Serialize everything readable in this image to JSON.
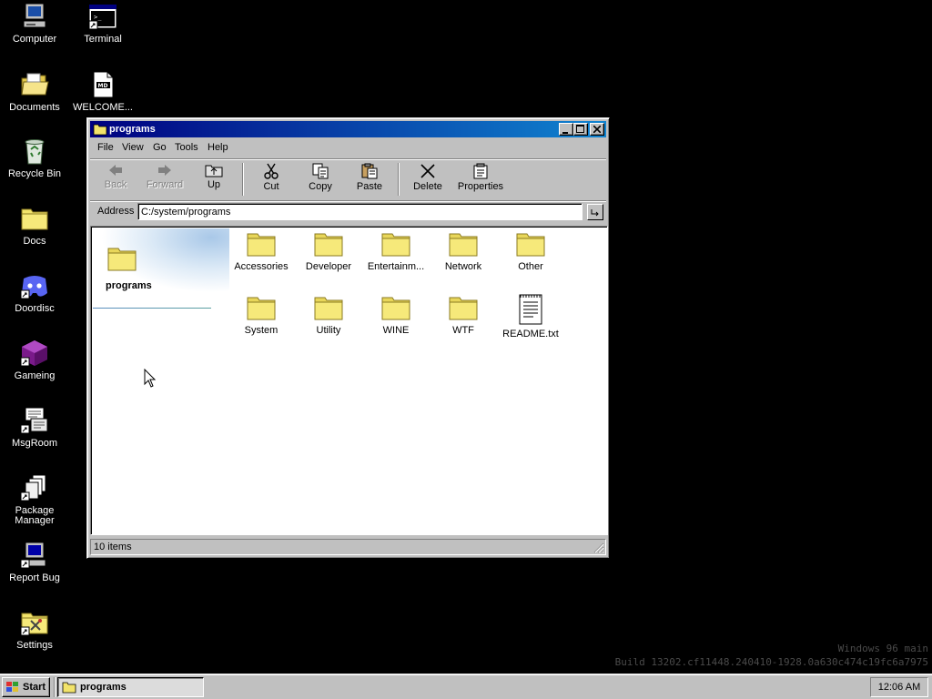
{
  "desktop": {
    "icons": [
      {
        "label": "Computer"
      },
      {
        "label": "Terminal"
      },
      {
        "label": "Documents"
      },
      {
        "label": "WELCOME...",
        "badge": "MD"
      },
      {
        "label": "Recycle Bin"
      },
      {
        "label": "Docs"
      },
      {
        "label": "Doordisc"
      },
      {
        "label": "Gameing"
      },
      {
        "label": "MsgRoom"
      },
      {
        "label": "Package Manager"
      },
      {
        "label": "Report Bug"
      },
      {
        "label": "Settings"
      }
    ]
  },
  "window": {
    "title": "programs",
    "menu": [
      "File",
      "View",
      "Go",
      "Tools",
      "Help"
    ],
    "toolbar": {
      "back": "Back",
      "forward": "Forward",
      "up": "Up",
      "cut": "Cut",
      "copy": "Copy",
      "paste": "Paste",
      "delete": "Delete",
      "properties": "Properties"
    },
    "address": {
      "label": "Address",
      "value": "C:/system/programs"
    },
    "side_panel": {
      "title": "programs"
    },
    "files": [
      {
        "name": "Accessories",
        "type": "folder"
      },
      {
        "name": "Developer",
        "type": "folder"
      },
      {
        "name": "Entertainm...",
        "type": "folder"
      },
      {
        "name": "Network",
        "type": "folder"
      },
      {
        "name": "Other",
        "type": "folder"
      },
      {
        "name": "System",
        "type": "folder"
      },
      {
        "name": "Utility",
        "type": "folder"
      },
      {
        "name": "WINE",
        "type": "folder"
      },
      {
        "name": "WTF",
        "type": "folder"
      },
      {
        "name": "README.txt",
        "type": "text-file"
      }
    ],
    "status": "10 items"
  },
  "watermark": {
    "line1": "Windows 96 main",
    "line2": "Build 13202.cf11448.240410-1928.0a630c474c19fc6a7975"
  },
  "taskbar": {
    "start_label": "Start",
    "task_label": "programs",
    "clock": "12:06 AM"
  },
  "colors": {
    "desktop": "#000000",
    "title_active_start": "#000080",
    "title_active_end": "#1084d0",
    "face": "#c0c0c0",
    "folder": "#f2e36a"
  }
}
